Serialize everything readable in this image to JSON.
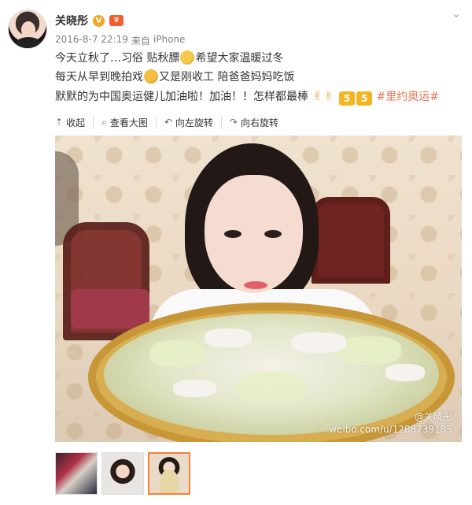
{
  "user": {
    "name": "关晓彤"
  },
  "post": {
    "date": "2016-8-7 22:19",
    "source_prefix": "来自",
    "source": "iPhone",
    "lines": [
      "今天立秋了…习俗 贴秋膘",
      "希望大家温暖过冬",
      "每天从早到晚拍戏",
      "又是刚收工 陪爸爸妈妈吃饭",
      "默默的为中国奥运健儿加油啦！加油！！怎样都最棒",
      "#里约奥运#"
    ],
    "badges": {
      "five_1": "5",
      "five_2": "5"
    }
  },
  "toolbar": {
    "collapse": "收起",
    "view_large": "查看大图",
    "rotate_left": "向左旋转",
    "rotate_right": "向右旋转"
  },
  "photo": {
    "watermark_name": "@关晓彤",
    "watermark_url": "weibo.com/u/1288739185"
  },
  "icons": {
    "collapse": "arrow-up-icon",
    "view_large": "magnifier-icon",
    "rotate_left": "rotate-left-icon",
    "rotate_right": "rotate-right-icon",
    "menu": "chevron-down-icon"
  },
  "colors": {
    "topic": "#eb7350",
    "verified": "#f5a623",
    "thumb_selected": "#fa7d3c"
  }
}
